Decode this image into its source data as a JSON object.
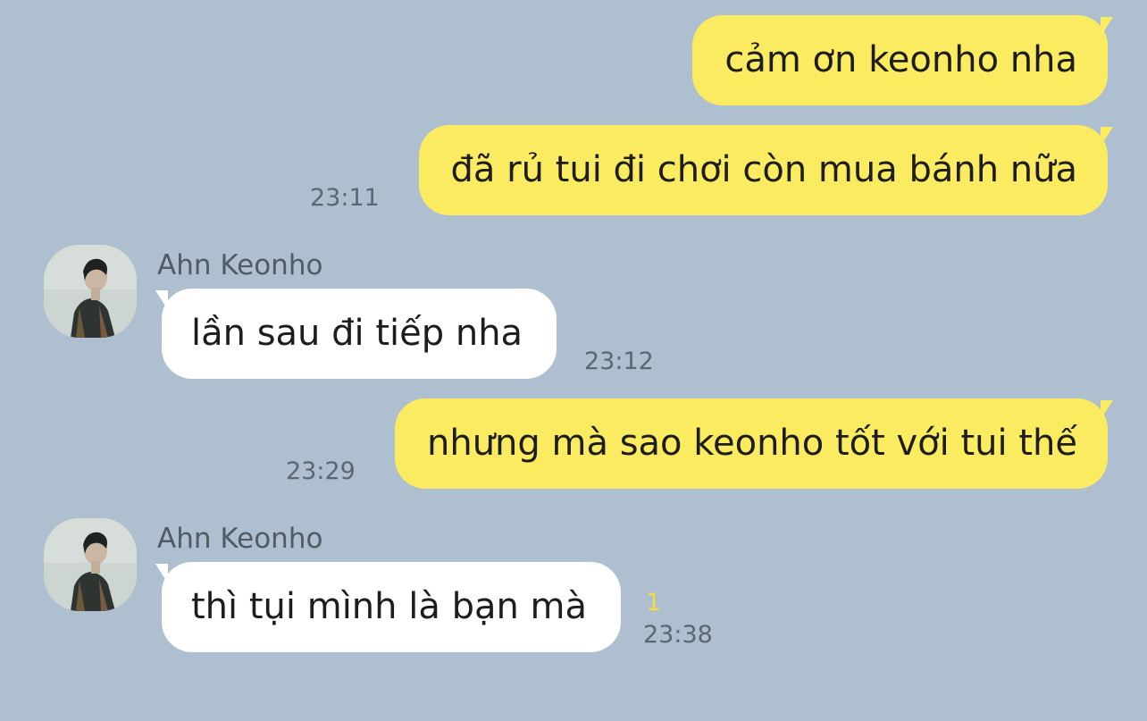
{
  "chat": {
    "messages": [
      {
        "from": "me",
        "text": "cảm ơn keonho nha",
        "time": ""
      },
      {
        "from": "me",
        "text": "đã rủ tui đi chơi còn mua bánh nữa",
        "time": "23:11"
      },
      {
        "from": "them",
        "sender": "Ahn Keonho",
        "text": "lần sau đi tiếp nha",
        "time": "23:12"
      },
      {
        "from": "me",
        "text": "nhưng mà sao keonho tốt với tui thế",
        "time": "23:29"
      },
      {
        "from": "them",
        "sender": "Ahn Keonho",
        "text": "thì tụi mình là bạn mà",
        "time": "23:38",
        "unread": "1"
      }
    ]
  },
  "colors": {
    "background": "#aebfd0",
    "my_bubble": "#fbeb61",
    "their_bubble": "#ffffff",
    "unread_count": "#f3dc3f"
  }
}
